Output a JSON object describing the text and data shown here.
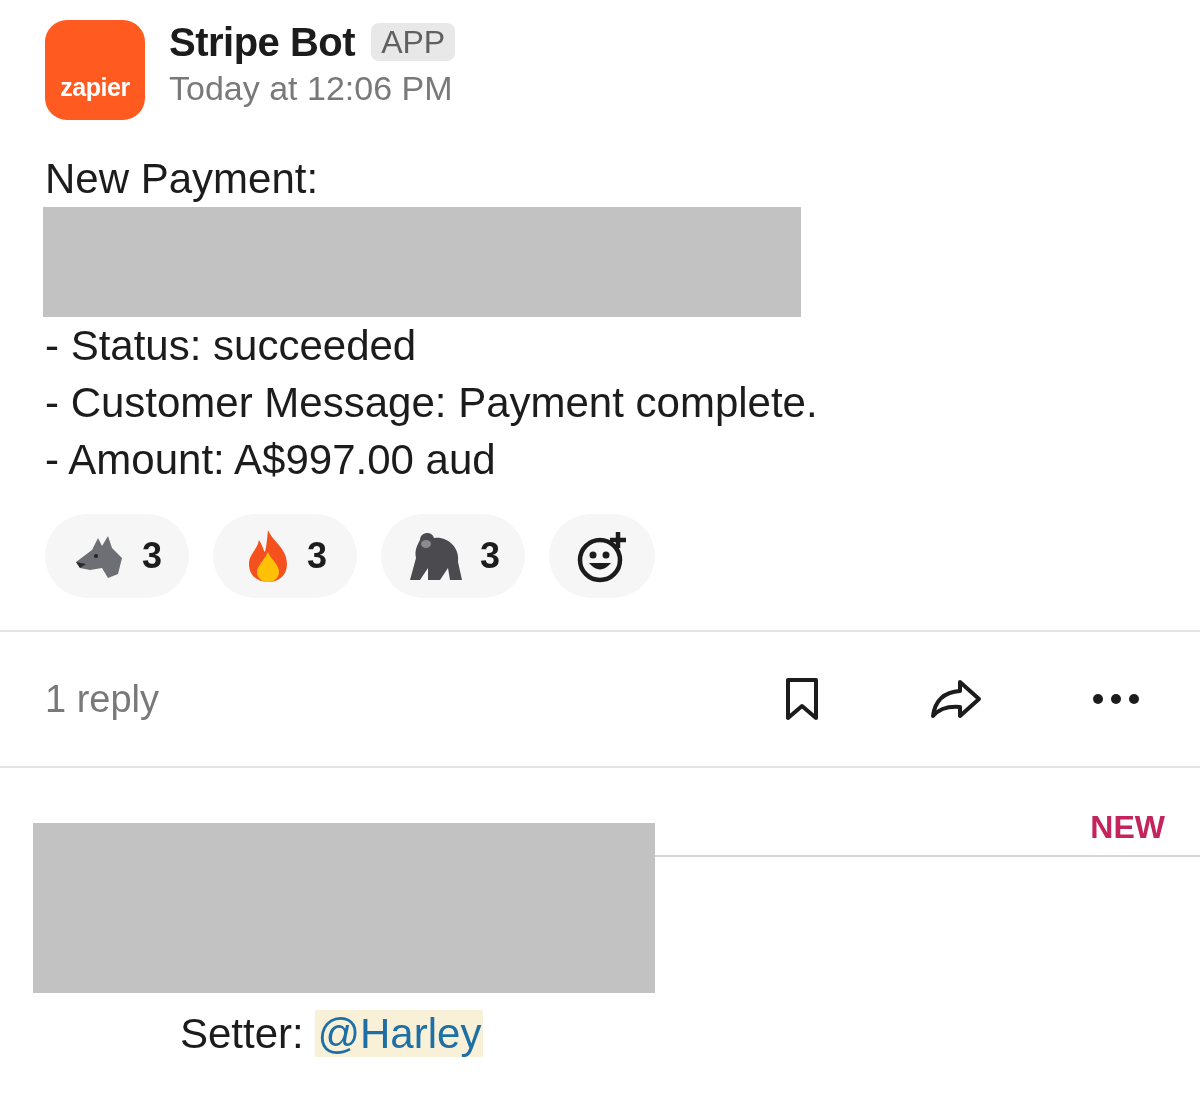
{
  "message": {
    "avatar_text": "zapier",
    "sender": "Stripe Bot",
    "badge": "APP",
    "time": "Today at 12:06 PM",
    "lines": [
      {
        "kind": "text",
        "text": "New Payment:"
      },
      {
        "kind": "redacted"
      },
      {
        "kind": "text",
        "text": "- Status: succeeded"
      },
      {
        "kind": "text",
        "text": "- Customer Message: Payment complete."
      },
      {
        "kind": "text",
        "text": "- Amount: A$997.00 aud"
      }
    ],
    "reactions": [
      {
        "count": "3"
      },
      {
        "count": "3"
      },
      {
        "count": "3"
      }
    ]
  },
  "thread": {
    "replies": "1 reply"
  },
  "new_label": "NEW",
  "reply": {
    "label": "Setter:",
    "mention": "@Harley"
  }
}
